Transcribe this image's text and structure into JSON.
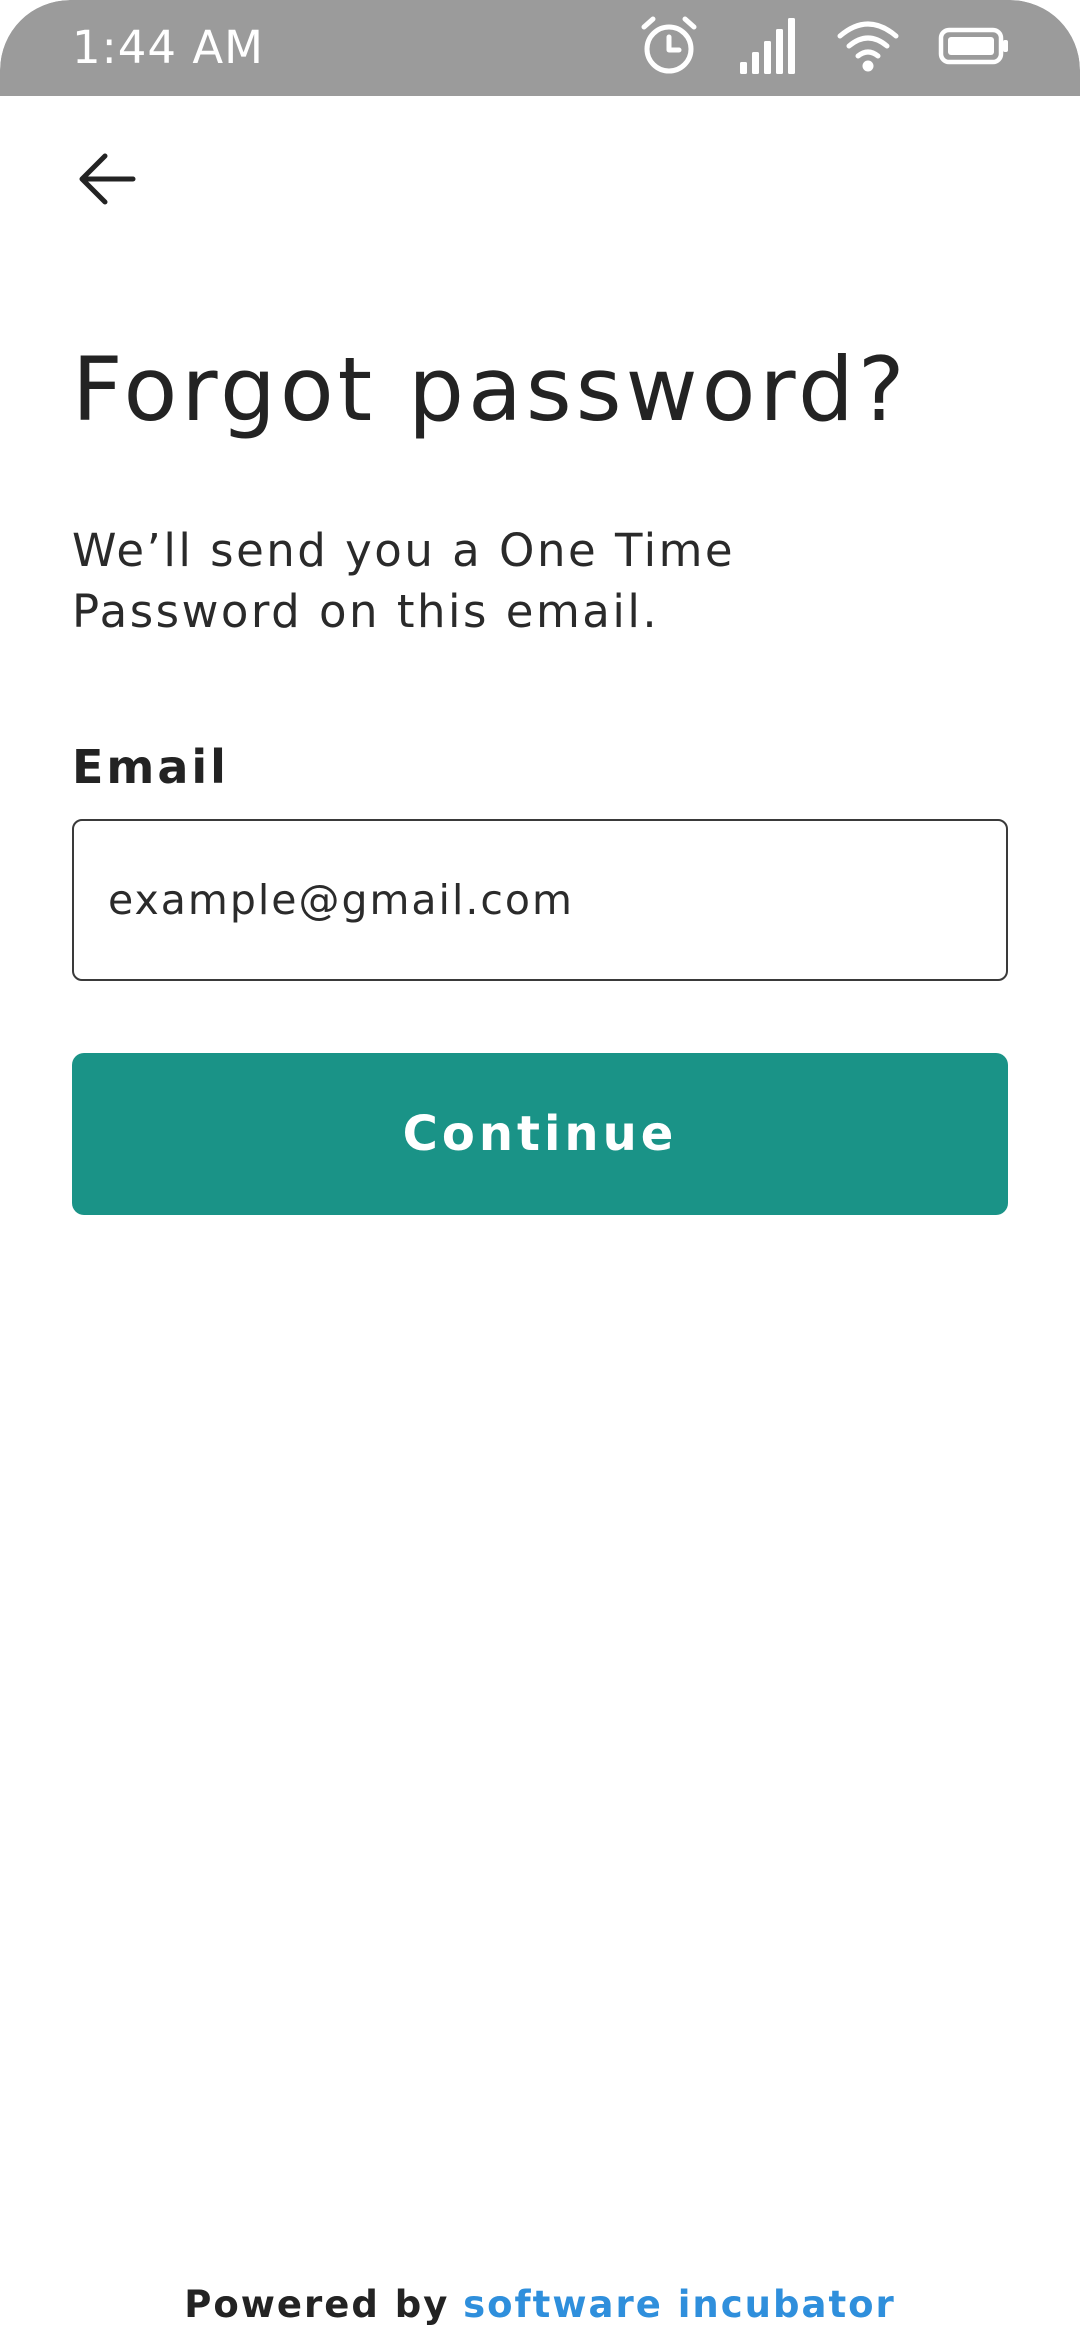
{
  "status_bar": {
    "time": "1:44 AM",
    "icons": [
      "alarm-icon",
      "cellular-signal-icon",
      "wifi-icon",
      "battery-icon"
    ],
    "background": "#9b9b9b"
  },
  "header": {
    "back_icon": "arrow-left-icon"
  },
  "main": {
    "title": "Forgot password?",
    "subtitle_line1": "We’ll send you a One Time",
    "subtitle_line2": "Password on this email.",
    "email_label": "Email",
    "email_placeholder": "example@gmail.com",
    "email_value": "",
    "continue_label": "Continue"
  },
  "footer": {
    "prefix": "Powered by",
    "link": "software incubator"
  },
  "colors": {
    "accent": "#1a9387",
    "link": "#2f8fdc",
    "text": "#232323"
  }
}
